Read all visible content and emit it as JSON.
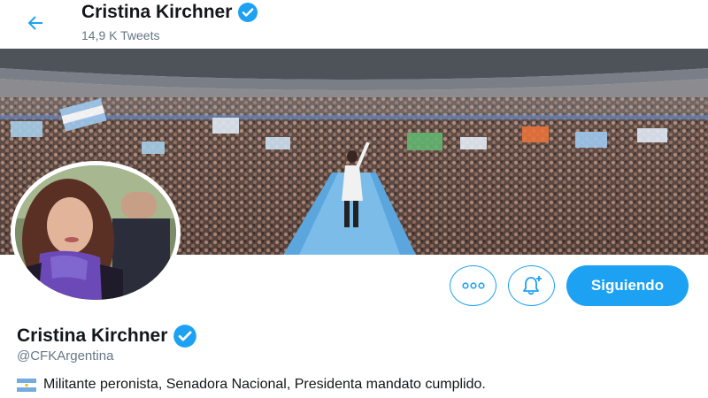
{
  "header": {
    "name": "Cristina Kirchner",
    "tweet_count": "14,9 K Tweets"
  },
  "actions": {
    "follow_label": "Siguiendo"
  },
  "profile": {
    "name": "Cristina Kirchner",
    "handle": "@CFKArgentina",
    "bio": "Militante peronista, Senadora Nacional, Presidenta mandato cumplido."
  },
  "icons": {
    "back": "arrow-left-icon",
    "verified": "verified-badge-icon",
    "more": "more-dots-icon",
    "notifications": "bell-plus-icon",
    "flag": "argentina-flag-icon"
  },
  "colors": {
    "accent": "#1da1f2",
    "text_primary": "#14171a",
    "text_secondary": "#657786"
  }
}
